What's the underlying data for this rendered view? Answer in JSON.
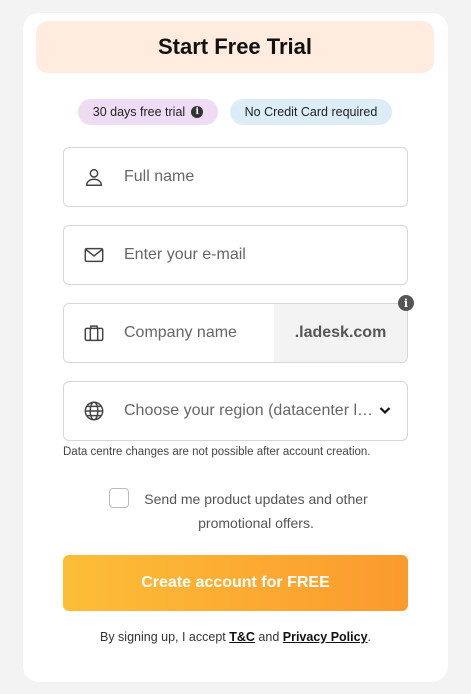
{
  "header": {
    "title": "Start Free Trial"
  },
  "badges": {
    "trial": "30 days free trial",
    "trial_info_glyph": "i",
    "no_card": "No Credit Card required"
  },
  "form": {
    "full_name": {
      "placeholder": "Full name",
      "icon": "user-icon"
    },
    "email": {
      "placeholder": "Enter your e-mail",
      "icon": "envelope-icon"
    },
    "company": {
      "placeholder": "Company name",
      "icon": "briefcase-icon",
      "suffix": ".ladesk.com",
      "info_glyph": "i"
    },
    "region": {
      "placeholder": "Choose your region (datacenter l…",
      "icon": "globe-icon"
    },
    "region_note": "Data centre changes are not possible after account creation.",
    "consent": {
      "checked": false,
      "label": "Send me product updates and other promotional offers."
    },
    "submit_label": "Create account for FREE"
  },
  "legal": {
    "prefix": "By signing up, I accept ",
    "tc": "T&C",
    "and": " and ",
    "privacy": "Privacy Policy",
    "suffix": "."
  },
  "colors": {
    "header_bg": "#ffecdf",
    "badge_trial_bg": "#eedcf4",
    "badge_card_bg": "#dcedf8",
    "cta_start": "#fdbe37",
    "cta_end": "#fb9a2e"
  }
}
